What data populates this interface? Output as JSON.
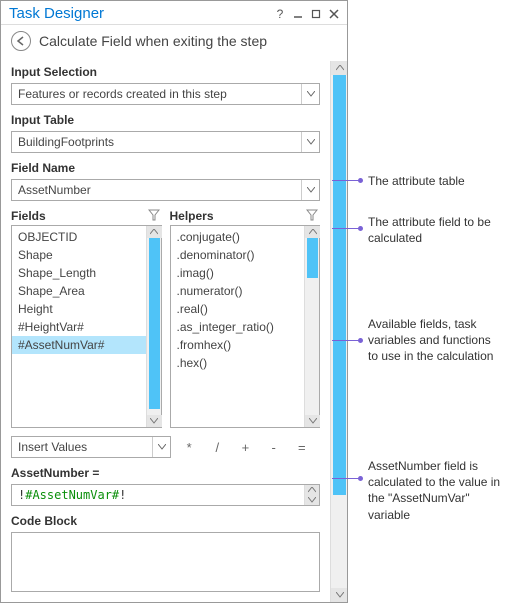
{
  "window": {
    "title": "Task Designer",
    "subtitle": "Calculate Field when exiting the step"
  },
  "sections": {
    "inputSelection": {
      "label": "Input Selection",
      "value": "Features or records created in this step"
    },
    "inputTable": {
      "label": "Input Table",
      "value": "BuildingFootprints"
    },
    "fieldName": {
      "label": "Field Name",
      "value": "AssetNumber"
    }
  },
  "fields": {
    "label": "Fields",
    "items": [
      "OBJECTID",
      "Shape",
      "Shape_Length",
      "Shape_Area",
      "Height",
      "#HeightVar#",
      "#AssetNumVar#"
    ],
    "selected": "#AssetNumVar#"
  },
  "helpers": {
    "label": "Helpers",
    "items": [
      ".conjugate()",
      ".denominator()",
      ".imag()",
      ".numerator()",
      ".real()",
      ".as_integer_ratio()",
      ".fromhex()",
      ".hex()"
    ]
  },
  "insert": {
    "value": "Insert Values"
  },
  "operators": {
    "items": [
      "*",
      "/",
      "+",
      "-",
      "="
    ]
  },
  "expression": {
    "label": "AssetNumber =",
    "value_prefix": "!",
    "value_green": "#AssetNumVar#",
    "value_suffix": "!"
  },
  "codeblock": {
    "label": "Code Block"
  },
  "annotations": {
    "a1": "The attribute table",
    "a2": "The attribute field to be calculated",
    "a3": "Available fields, task variables and functions to use in the calculation",
    "a4": "AssetNumber field is calculated to the value in the \"AssetNumVar\" variable"
  }
}
